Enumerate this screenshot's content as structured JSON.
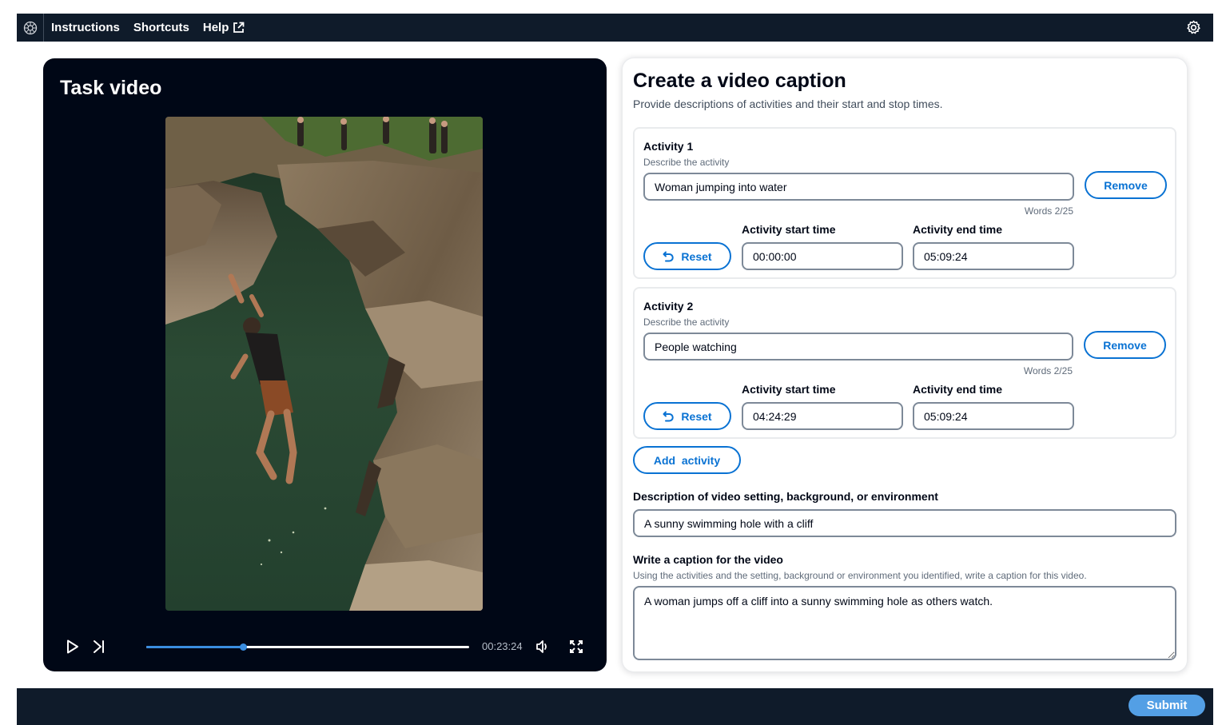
{
  "nav": {
    "links": [
      "Instructions",
      "Shortcuts",
      "Help"
    ]
  },
  "video": {
    "title": "Task video",
    "time": "00:23:24",
    "progress_fraction": 0.3
  },
  "form": {
    "title": "Create a video caption",
    "subtitle": "Provide descriptions of activities and their start and stop times.",
    "activities": [
      {
        "label": "Activity 1",
        "desc_label": "Describe the activity",
        "description": "Woman jumping into water",
        "words": "Words 2/25",
        "start_label": "Activity start time",
        "start": "00:00:00",
        "end_label": "Activity end time",
        "end": "05:09:24",
        "reset_label": "Reset",
        "remove_label": "Remove"
      },
      {
        "label": "Activity 2",
        "desc_label": "Describe the activity",
        "description": "People watching",
        "words": "Words 2/25",
        "start_label": "Activity start time",
        "start": "04:24:29",
        "end_label": "Activity end time",
        "end": "05:09:24",
        "reset_label": "Reset",
        "remove_label": "Remove"
      }
    ],
    "add_activity_label": "Add  activity",
    "setting_label": "Description of video setting, background, or environment",
    "setting_value": "A sunny swimming hole with a cliff",
    "caption_label": "Write a caption for the video",
    "caption_desc": "Using the activities and the setting, background or environment you identified, write a caption for this video.",
    "caption_value": "A woman jumps off a cliff into a sunny swimming hole as others watch."
  },
  "footer": {
    "submit_label": "Submit"
  },
  "colors": {
    "nav_bg": "#0f1b2a",
    "video_bg": "#000716",
    "accent": "#0972d3",
    "progress": "#3a8de0",
    "submit_bg": "#539fe5"
  }
}
